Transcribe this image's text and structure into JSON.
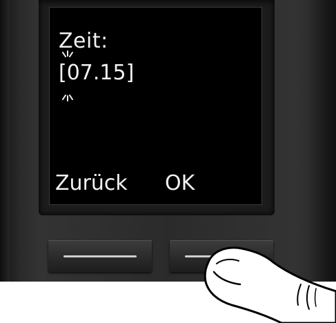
{
  "screen": {
    "title": "Zeit:",
    "time_value": "[07.15]"
  },
  "softkeys": {
    "left_label": "Zurück",
    "right_label": "OK"
  },
  "icons": {
    "cursor_blink": "blink-indicator-icon",
    "finger": "finger-press-icon"
  },
  "colors": {
    "screen_bg": "#000000",
    "screen_text": "#f2f2f2",
    "device_body": "#2b2b2b"
  }
}
